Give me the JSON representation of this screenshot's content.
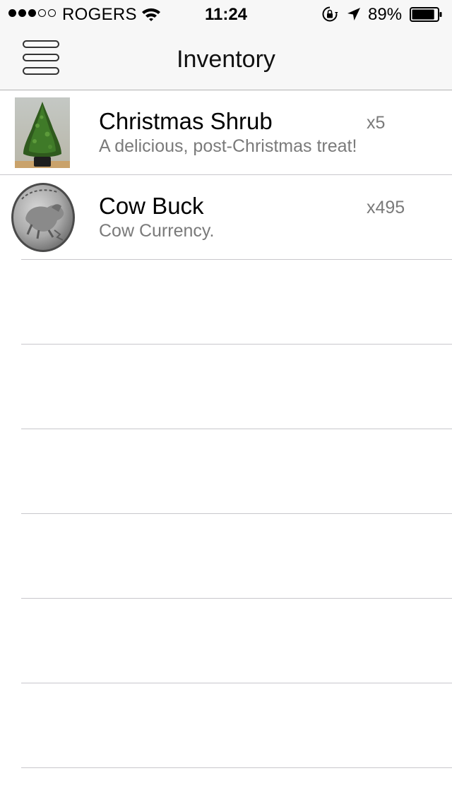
{
  "status_bar": {
    "carrier": "ROGERS",
    "time": "11:24",
    "battery_percent": "89%",
    "battery_level": 0.89,
    "signal_bars_filled": 3,
    "signal_bars_total": 5,
    "icons": [
      "signal-dots-icon",
      "wifi-icon",
      "rotation-lock-icon",
      "location-arrow-icon",
      "battery-icon"
    ]
  },
  "navbar": {
    "title": "Inventory",
    "menu_icon": "hamburger-menu-icon"
  },
  "inventory": {
    "items": [
      {
        "name": "Christmas Shrub",
        "description": "A delicious, post-Christmas treat!",
        "quantity": "x5",
        "image": "christmas-tree-image"
      },
      {
        "name": "Cow Buck",
        "description": "Cow Currency.",
        "quantity": "x495",
        "image": "coin-image"
      }
    ],
    "empty_rows": 6
  },
  "colors": {
    "bar_background": "#f7f7f7",
    "separator": "#c8c7cc",
    "secondary_text": "#7a7a7a"
  }
}
